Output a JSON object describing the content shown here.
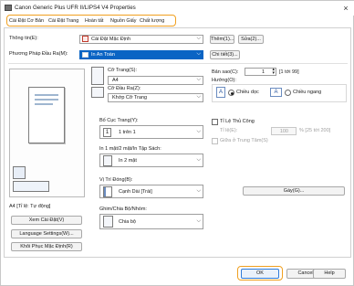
{
  "window": {
    "title": "Canon Generic Plus UFR II/LIPS4 V4 Properties",
    "close": "×"
  },
  "tabs": [
    "Cài Đặt Cơ Bản",
    "Cài Đặt Trang",
    "Hoàn tất",
    "Nguồn Giấy",
    "Chất lượng"
  ],
  "profile": {
    "label": "Thông tin(E):",
    "value": "Cài Đặt Mặc Định",
    "add": "Thêm(1)...",
    "edit": "Sửa(2)..."
  },
  "output_method": {
    "label": "Phương Pháp Đầu Ra(M):",
    "value": "In An Toàn",
    "details": "Chi tiết(3)..."
  },
  "preview": {
    "caption": "A4 [Tỉ lệ: Tự động]"
  },
  "left_buttons": {
    "view_settings": "Xem Cài Đặt(V)",
    "language": "Language Settings(W)...",
    "restore": "Khôi Phục Mặc Định(R)"
  },
  "page_size": {
    "label": "Cỡ Trang(S):",
    "value": "A4"
  },
  "output_size": {
    "label": "Cỡ Đầu Ra(Z):",
    "value": "Khớp Cỡ Trang"
  },
  "copies": {
    "label": "Bản sao(C):",
    "value": "1",
    "range": "[1 tới 99]"
  },
  "orientation": {
    "label": "Hướng(O):",
    "portrait": "Chiều dọc",
    "landscape": "Chiều ngang",
    "letter": "A"
  },
  "layout": {
    "label": "Bố Cục Trang(Y):",
    "value": "1 trên 1",
    "num": "1"
  },
  "manual_scaling": {
    "label": "Tỉ Lệ Thủ Công",
    "scale_label": "Tỉ lệ(E):",
    "scale_value": "100",
    "scale_range": "% [25 tới 200]"
  },
  "center_page": {
    "label": "Giữa ở Trung Tâm(S)"
  },
  "print_style": {
    "label": "In 1 mặt/2 mặt/In Tập Sách:",
    "value": "In 2 mặt"
  },
  "binding": {
    "label": "Vị Trí Đóng(B):",
    "value": "Cạnh Dài [Trái]",
    "margin": "Gáy(G)..."
  },
  "finishing": {
    "label": "Ghim/Chia Bộ/Nhóm:",
    "value": "Chia bộ"
  },
  "footer": {
    "ok": "OK",
    "cancel": "Cancel",
    "help": "Help"
  },
  "colors": {
    "accent": "#f0a020",
    "selection": "#0a64c4"
  }
}
